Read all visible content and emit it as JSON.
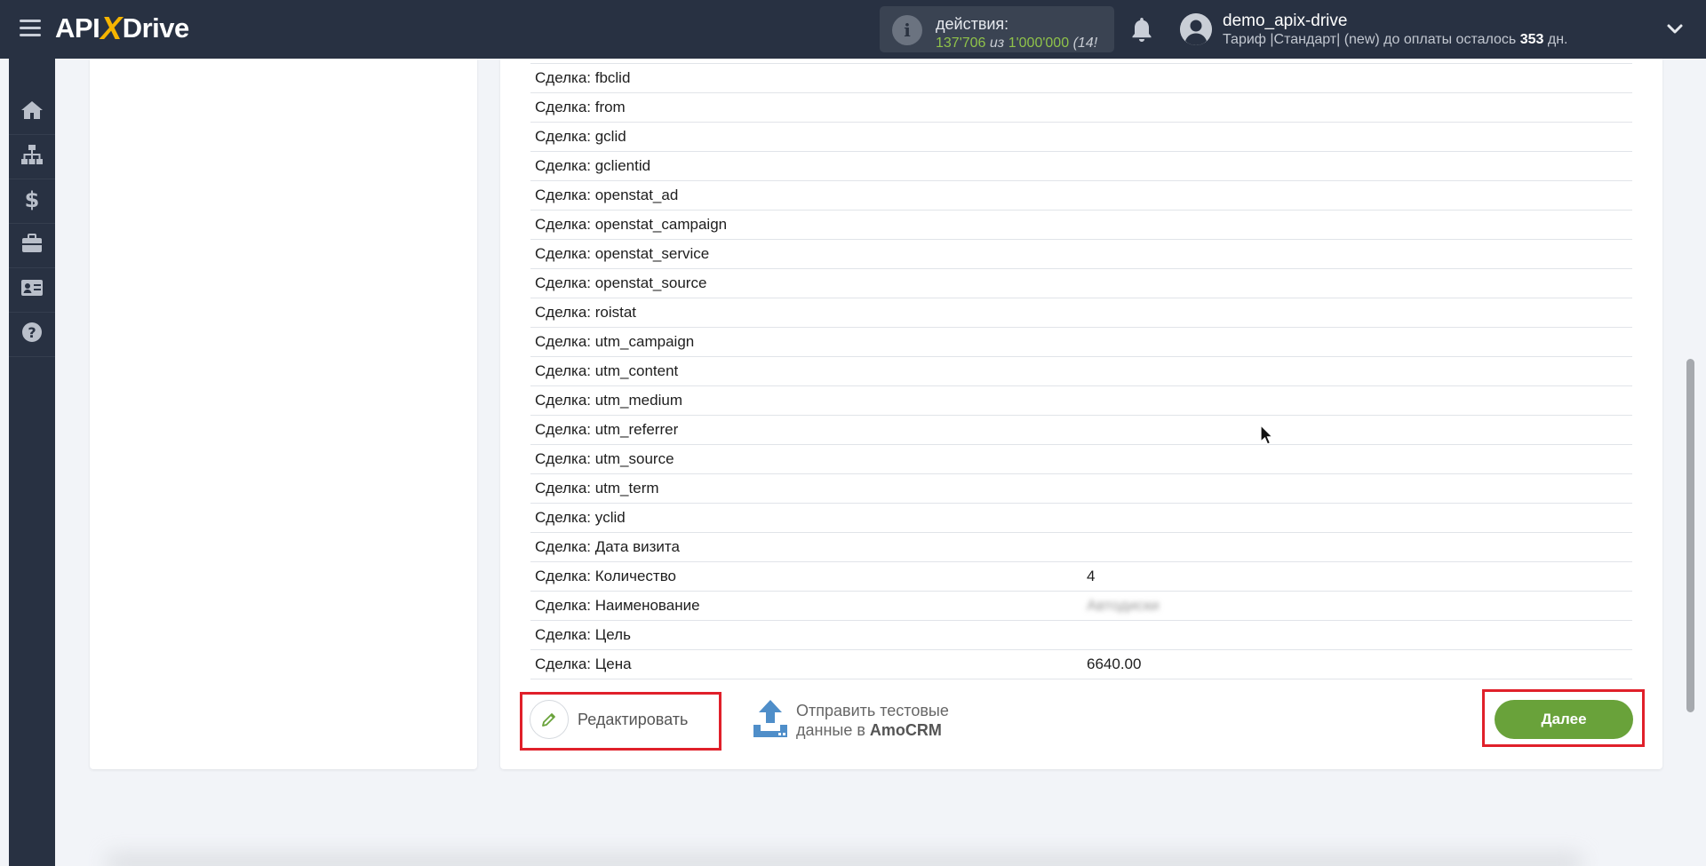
{
  "header": {
    "logo": {
      "prefix": "API",
      "x": "X",
      "suffix": "Drive"
    },
    "actions": {
      "title": "действия:",
      "used": "137'706",
      "of": "из",
      "total": "1'000'000",
      "extra": "(14!"
    },
    "user": {
      "name": "demo_apix-drive",
      "plan_text": "Тариф |Стандарт| (new) до оплаты осталось",
      "days": "353",
      "days_unit": "дн."
    }
  },
  "sidebar": {
    "items": [
      {
        "icon": "home-icon"
      },
      {
        "icon": "sitemap-icon"
      },
      {
        "icon": "dollar-icon"
      },
      {
        "icon": "briefcase-icon"
      },
      {
        "icon": "id-card-icon"
      },
      {
        "icon": "help-icon"
      }
    ]
  },
  "fields": [
    {
      "label": "Сделка: fbclid",
      "value": ""
    },
    {
      "label": "Сделка: from",
      "value": ""
    },
    {
      "label": "Сделка: gclid",
      "value": ""
    },
    {
      "label": "Сделка: gclientid",
      "value": ""
    },
    {
      "label": "Сделка: openstat_ad",
      "value": ""
    },
    {
      "label": "Сделка: openstat_campaign",
      "value": ""
    },
    {
      "label": "Сделка: openstat_service",
      "value": ""
    },
    {
      "label": "Сделка: openstat_source",
      "value": ""
    },
    {
      "label": "Сделка: roistat",
      "value": ""
    },
    {
      "label": "Сделка: utm_campaign",
      "value": ""
    },
    {
      "label": "Сделка: utm_content",
      "value": ""
    },
    {
      "label": "Сделка: utm_medium",
      "value": ""
    },
    {
      "label": "Сделка: utm_referrer",
      "value": ""
    },
    {
      "label": "Сделка: utm_source",
      "value": ""
    },
    {
      "label": "Сделка: utm_term",
      "value": ""
    },
    {
      "label": "Сделка: yclid",
      "value": ""
    },
    {
      "label": "Сделка: Дата визита",
      "value": ""
    },
    {
      "label": "Сделка: Количество",
      "value": "4"
    },
    {
      "label": "Сделка: Наименование",
      "value": "Автодиски",
      "blurred": true
    },
    {
      "label": "Сделка: Цель",
      "value": ""
    },
    {
      "label": "Сделка: Цена",
      "value": "6640.00"
    }
  ],
  "buttons": {
    "edit": "Редактировать",
    "send_line1": "Отправить тестовые",
    "send_line2_prefix": "данные в",
    "send_target": "AmoCRM",
    "next": "Далее"
  },
  "colors": {
    "topbar": "#283142",
    "accent_green": "#69a23a",
    "highlight_red": "#e0202a",
    "count_green": "#8fc24a"
  }
}
